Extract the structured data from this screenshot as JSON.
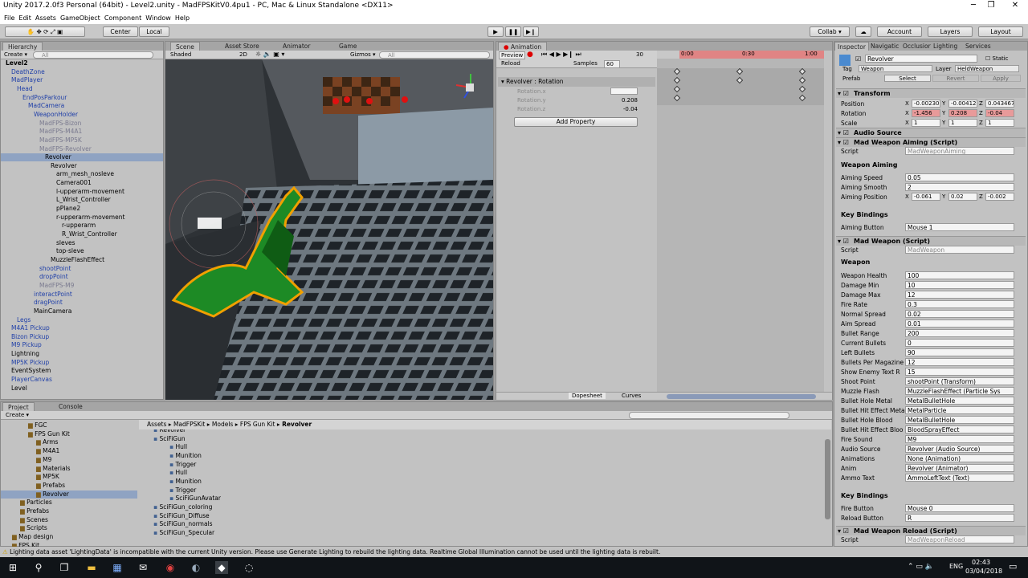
{
  "window": {
    "title": "Unity 2017.2.0f3 Personal (64bit) - Level2.unity - MadFPSKitV0.4pu1 - PC, Mac & Linux Standalone <DX11>",
    "minimize": "─",
    "maximize": "❐",
    "close": "✕"
  },
  "menu": [
    "File",
    "Edit",
    "Assets",
    "GameObject",
    "Component",
    "Window",
    "Help"
  ],
  "toolbar": {
    "center": "Center",
    "local": "Local",
    "collab": "Collab ▾",
    "account": "Account",
    "layers": "Layers",
    "layout": "Layout"
  },
  "hierarchy": {
    "tab": "Hierarchy",
    "create": "Create ▾",
    "search": "All",
    "items": [
      {
        "label": "Level2",
        "depth": 0
      },
      {
        "label": "DeathZone",
        "depth": 1
      },
      {
        "label": "MadPlayer",
        "depth": 1
      },
      {
        "label": "Head",
        "depth": 2
      },
      {
        "label": "EndPosParkour",
        "depth": 3
      },
      {
        "label": "MadCamera",
        "depth": 4
      },
      {
        "label": "WeaponHolder",
        "depth": 5
      },
      {
        "label": "MadFPS-Bizon",
        "depth": 6
      },
      {
        "label": "MadFPS-M4A1",
        "depth": 6
      },
      {
        "label": "MadFPS-MP5K",
        "depth": 6
      },
      {
        "label": "MadFPS-Revolver",
        "depth": 6
      },
      {
        "label": "Revolver",
        "depth": 7
      },
      {
        "label": "Revolver",
        "depth": 8
      },
      {
        "label": "arm_mesh_nosleve",
        "depth": 9
      },
      {
        "label": "Camera001",
        "depth": 9
      },
      {
        "label": "l-upperarm-movement",
        "depth": 9
      },
      {
        "label": "L_Wrist_Controller",
        "depth": 9
      },
      {
        "label": "pPlane2",
        "depth": 9
      },
      {
        "label": "r-upperarm-movement",
        "depth": 9
      },
      {
        "label": "r-upperarm",
        "depth": 10
      },
      {
        "label": "R_Wrist_Controller",
        "depth": 10
      },
      {
        "label": "sleves",
        "depth": 9
      },
      {
        "label": "top-sleve",
        "depth": 9
      },
      {
        "label": "MuzzleFlashEffect",
        "depth": 8
      },
      {
        "label": "shootPoint",
        "depth": 6
      },
      {
        "label": "dropPoint",
        "depth": 6
      },
      {
        "label": "MadFPS-M9",
        "depth": 6
      },
      {
        "label": "interactPoint",
        "depth": 5
      },
      {
        "label": "dragPoint",
        "depth": 5
      },
      {
        "label": "MainCamera",
        "depth": 5
      },
      {
        "label": "Legs",
        "depth": 2
      },
      {
        "label": "M4A1 Pickup",
        "depth": 1
      },
      {
        "label": "Bizon Pickup",
        "depth": 1
      },
      {
        "label": "M9 Pickup",
        "depth": 1
      },
      {
        "label": "Lightning",
        "depth": 1
      },
      {
        "label": "MP5K Pickup",
        "depth": 1
      },
      {
        "label": "EventSystem",
        "depth": 1
      },
      {
        "label": "PlayerCanvas",
        "depth": 1
      },
      {
        "label": "Level",
        "depth": 1
      }
    ]
  },
  "scene": {
    "tabs": [
      "Scene",
      "Asset Store",
      "Animator",
      "Game"
    ],
    "shaded": "Shaded",
    "mode2d": "2D",
    "gizmos": "Gizmos ▾",
    "search": "All"
  },
  "animation": {
    "tab": "Animation",
    "preview": "Preview",
    "clip": "Reload",
    "samples_label": "Samples",
    "samples": "60",
    "frame": "30",
    "times": [
      "0:00",
      "0:30",
      "1:00"
    ],
    "object": "Revolver : Rotation",
    "props": [
      {
        "name": "Rotation.x",
        "value": ""
      },
      {
        "name": "Rotation.y",
        "value": "0.208"
      },
      {
        "name": "Rotation.z",
        "value": "-0.04"
      }
    ],
    "add": "Add Property",
    "dopesheet": "Dopesheet",
    "curves": "Curves"
  },
  "inspector": {
    "tabs": [
      "Inspector",
      "Navigatic",
      "Occlusior",
      "Lighting",
      "Services"
    ],
    "object": "Revolver",
    "static": "Static",
    "tag_label": "Tag",
    "tag": "Weapon",
    "layer_label": "Layer",
    "layer": "HeldWeapon",
    "prefab_label": "Prefab",
    "select": "Select",
    "revert": "Revert",
    "apply": "Apply",
    "transform": {
      "title": "Transform",
      "position_label": "Position",
      "rotation_label": "Rotation",
      "scale_label": "Scale",
      "position": [
        "-0.00230",
        "-0.00412",
        "0.043467"
      ],
      "rotation": [
        "-1.456",
        "0.208",
        "-0.04"
      ],
      "scale": [
        "1",
        "1",
        "1"
      ]
    },
    "audio": "Audio Source",
    "aiming": {
      "title": "Mad Weapon Aiming (Script)",
      "script_label": "Script",
      "script": "MadWeaponAiming",
      "section": "Weapon Aiming",
      "fields": [
        [
          "Aiming Speed",
          "0.05"
        ],
        [
          "Aiming Smooth",
          "2"
        ]
      ],
      "pos_label": "Aiming Position",
      "pos": [
        "-0.061",
        "0.02",
        "-0.002"
      ],
      "kb": "Key Bindings",
      "btn_label": "Aiming Button",
      "btn": "Mouse 1"
    },
    "weapon": {
      "title": "Mad Weapon (Script)",
      "script_label": "Script",
      "script": "MadWeapon",
      "section": "Weapon",
      "fields": [
        [
          "Weapon Health",
          "100"
        ],
        [
          "Damage Min",
          "10"
        ],
        [
          "Damage Max",
          "12"
        ],
        [
          "Fire Rate",
          "0.3"
        ],
        [
          "Normal Spread",
          "0.02"
        ],
        [
          "Aim Spread",
          "0.01"
        ],
        [
          "Bullet Range",
          "200"
        ],
        [
          "Current Bullets",
          "0"
        ],
        [
          "Left Bullets",
          "90"
        ],
        [
          "Bullets Per Magazine",
          "12"
        ],
        [
          "Show Enemy Text R",
          "15"
        ],
        [
          "Shoot Point",
          "shootPoint (Transform)"
        ],
        [
          "Muzzle Flash",
          "MuzzleFlashEffect (Particle Sys"
        ],
        [
          "Bullet Hole Metal",
          "MetalBulletHole"
        ],
        [
          "Bullet Hit Effect Meta",
          "MetalParticle"
        ],
        [
          "Bullet Hole Blood",
          "MetalBulletHole"
        ],
        [
          "Bullet Hit Effect Bloo",
          "BloodSprayEffect"
        ],
        [
          "Fire Sound",
          "M9"
        ],
        [
          "Audio Source",
          "Revolver (Audio Source)"
        ],
        [
          "Animations",
          "None (Animation)"
        ],
        [
          "Anim",
          "Revolver (Animator)"
        ],
        [
          "Ammo Text",
          "AmmoLeftText (Text)"
        ]
      ],
      "kb": "Key Bindings",
      "fire_label": "Fire Button",
      "fire": "Mouse 0",
      "reload_label": "Reload Button",
      "reload": "R"
    },
    "reload": {
      "title": "Mad Weapon Reload (Script)",
      "script_label": "Script",
      "script": "MadWeaponReload"
    }
  },
  "project": {
    "tabs": [
      "Project",
      "Console"
    ],
    "create": "Create ▾",
    "folders": [
      {
        "label": "FGC",
        "depth": 2
      },
      {
        "label": "FPS Gun Kit",
        "depth": 2
      },
      {
        "label": "Arms",
        "depth": 3
      },
      {
        "label": "M4A1",
        "depth": 3
      },
      {
        "label": "M9",
        "depth": 3
      },
      {
        "label": "Materials",
        "depth": 3
      },
      {
        "label": "MP5K",
        "depth": 3
      },
      {
        "label": "Prefabs",
        "depth": 3
      },
      {
        "label": "Revolver",
        "depth": 3
      },
      {
        "label": "Particles",
        "depth": 1
      },
      {
        "label": "Prefabs",
        "depth": 1
      },
      {
        "label": "Scenes",
        "depth": 1
      },
      {
        "label": "Scripts",
        "depth": 1
      },
      {
        "label": "Map design",
        "depth": 0
      },
      {
        "label": "FPS Kit",
        "depth": 0
      }
    ],
    "breadcrumb": [
      "Assets",
      "MadFPSKit",
      "Models",
      "FPS Gun Kit",
      "Revolver"
    ],
    "assets": [
      {
        "label": "Revolver",
        "depth": 0
      },
      {
        "label": "SciFiGun",
        "depth": 0
      },
      {
        "label": "Hull",
        "depth": 1
      },
      {
        "label": "Munition",
        "depth": 1
      },
      {
        "label": "Trigger",
        "depth": 1
      },
      {
        "label": "Hull",
        "depth": 1
      },
      {
        "label": "Munition",
        "depth": 1
      },
      {
        "label": "Trigger",
        "depth": 1
      },
      {
        "label": "SciFiGunAvatar",
        "depth": 1
      },
      {
        "label": "SciFiGun_coloring",
        "depth": 0
      },
      {
        "label": "SciFiGun_Diffuse",
        "depth": 0
      },
      {
        "label": "SciFiGun_normals",
        "depth": 0
      },
      {
        "label": "SciFiGun_Specular",
        "depth": 0
      }
    ]
  },
  "status": "Lighting data asset 'LightingData' is incompatible with the current Unity version. Please use Generate Lighting to rebuild the lighting data.  Realtime Global Illumination cannot be used until the lighting data is rebuilt.",
  "taskbar": {
    "time": "02:43",
    "date": "03/04/2018",
    "lang": "ENG"
  }
}
